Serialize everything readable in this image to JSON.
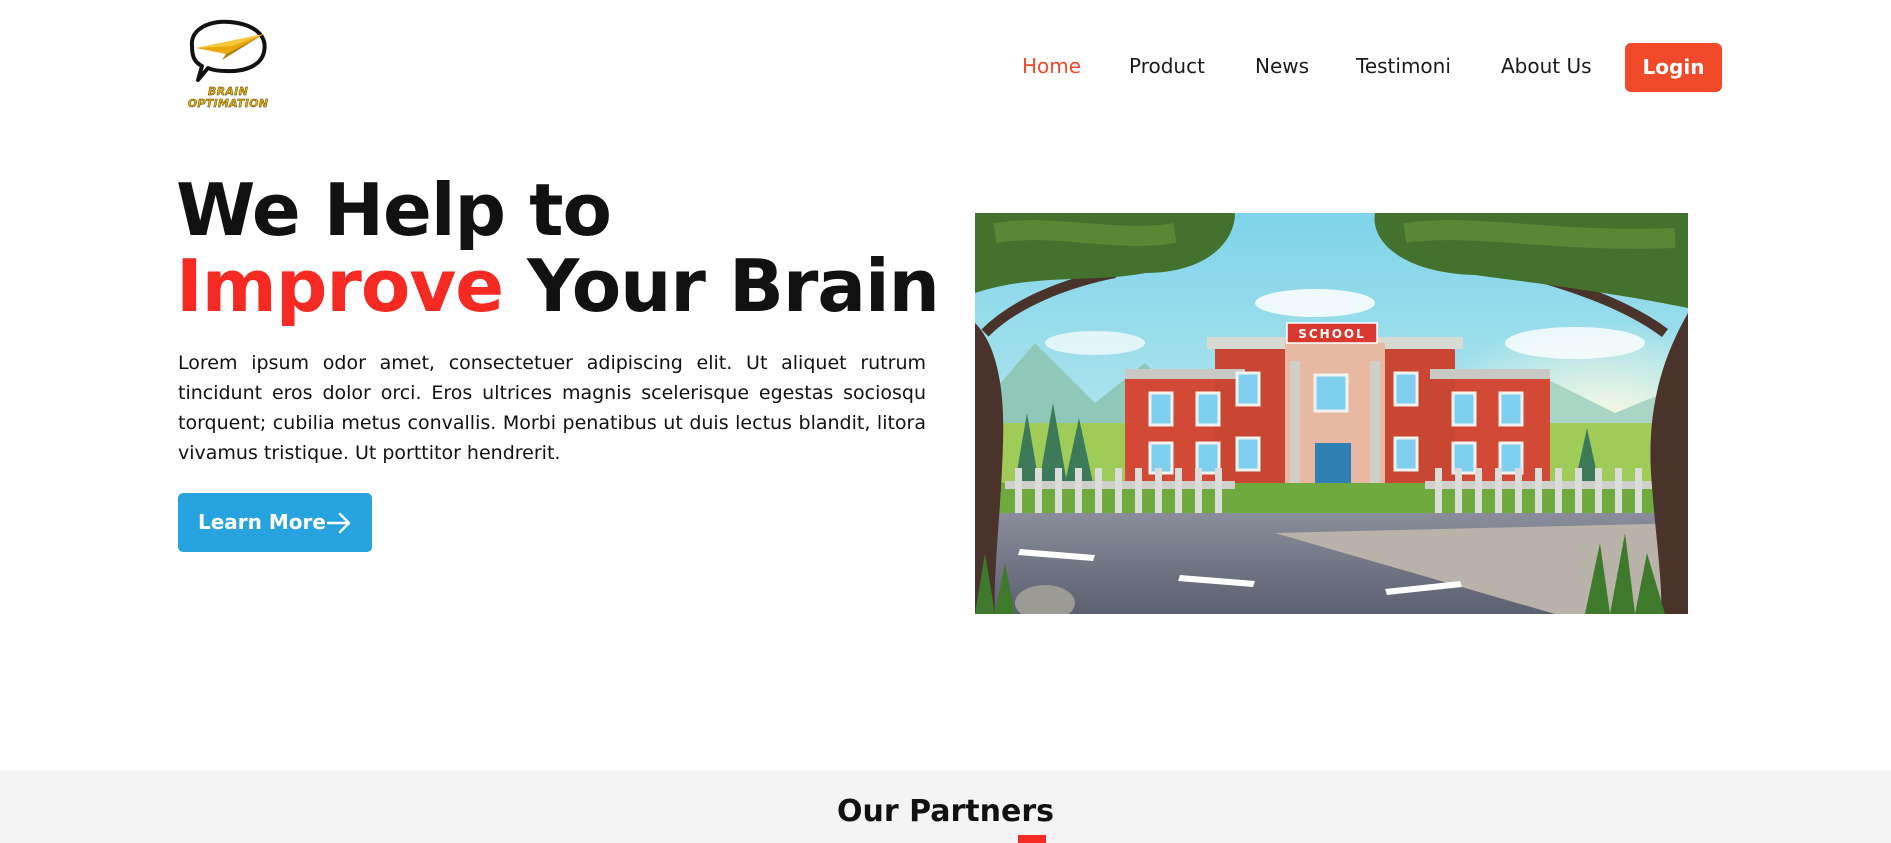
{
  "brand": {
    "logo_line1": "BRAIN",
    "logo_line2": "OPTIMATION"
  },
  "nav": {
    "items": [
      {
        "label": "Home",
        "active": true
      },
      {
        "label": "Product",
        "active": false
      },
      {
        "label": "News",
        "active": false
      },
      {
        "label": "Testimoni",
        "active": false
      },
      {
        "label": "About Us",
        "active": false
      }
    ],
    "login_label": "Login"
  },
  "hero": {
    "title_line1": "We Help to",
    "title_accent": "Improve",
    "title_rest": " Your Brain",
    "description": "Lorem ipsum odor amet, consectetuer adipiscing elit. Ut aliquet rutrum tincidunt eros dolor orci. Eros ultrices magnis scelerisque egestas sociosqu torquent; cubilia metus convallis. Morbi penatibus ut duis lectus blandit, litora vivamus tristique. Ut porttitor hendrerit.",
    "cta_label": "Learn More",
    "image_sign": "SCHOOL"
  },
  "partners": {
    "title": "Our Partners"
  },
  "colors": {
    "accent": "#f04a2a",
    "title_accent": "#f52a22",
    "cta": "#27a3df",
    "partners_bg": "#f4f4f4"
  }
}
